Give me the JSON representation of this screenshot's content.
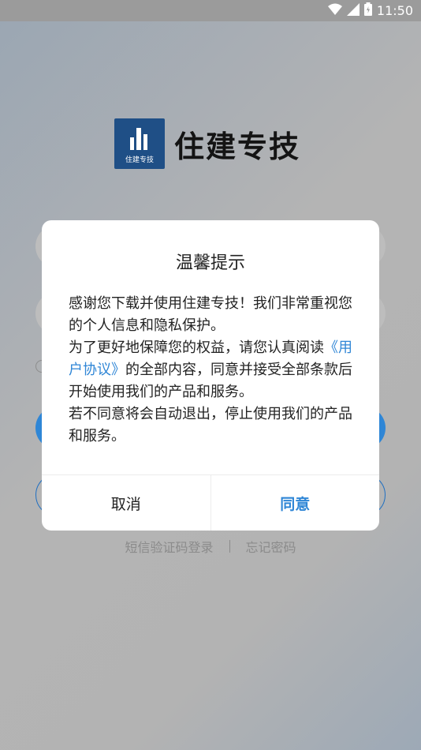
{
  "status_bar": {
    "time": "11:50",
    "icons": [
      "wifi-icon",
      "signal-icon",
      "battery-icon"
    ]
  },
  "app": {
    "logo_small_text": "住建专技",
    "logo_text": "住建专技"
  },
  "background_links": {
    "sms_login": "短信验证码登录",
    "forgot_password": "忘记密码"
  },
  "dialog": {
    "title": "温馨提示",
    "para1": "感谢您下载并使用住建专技！我们非常重视您的个人信息和隐私保护。",
    "para2_prefix": "为了更好地保障您的权益，请您认真阅读",
    "agreement_link": "《用户协议》",
    "para2_suffix": "的全部内容，同意并接受全部条款后开始使用我们的产品和服务。",
    "para3": "若不同意将会自动退出，停止使用我们的产品和服务。",
    "cancel_label": "取消",
    "agree_label": "同意"
  },
  "colors": {
    "accent": "#2f86d6",
    "logo_bg": "#1f4f86"
  }
}
